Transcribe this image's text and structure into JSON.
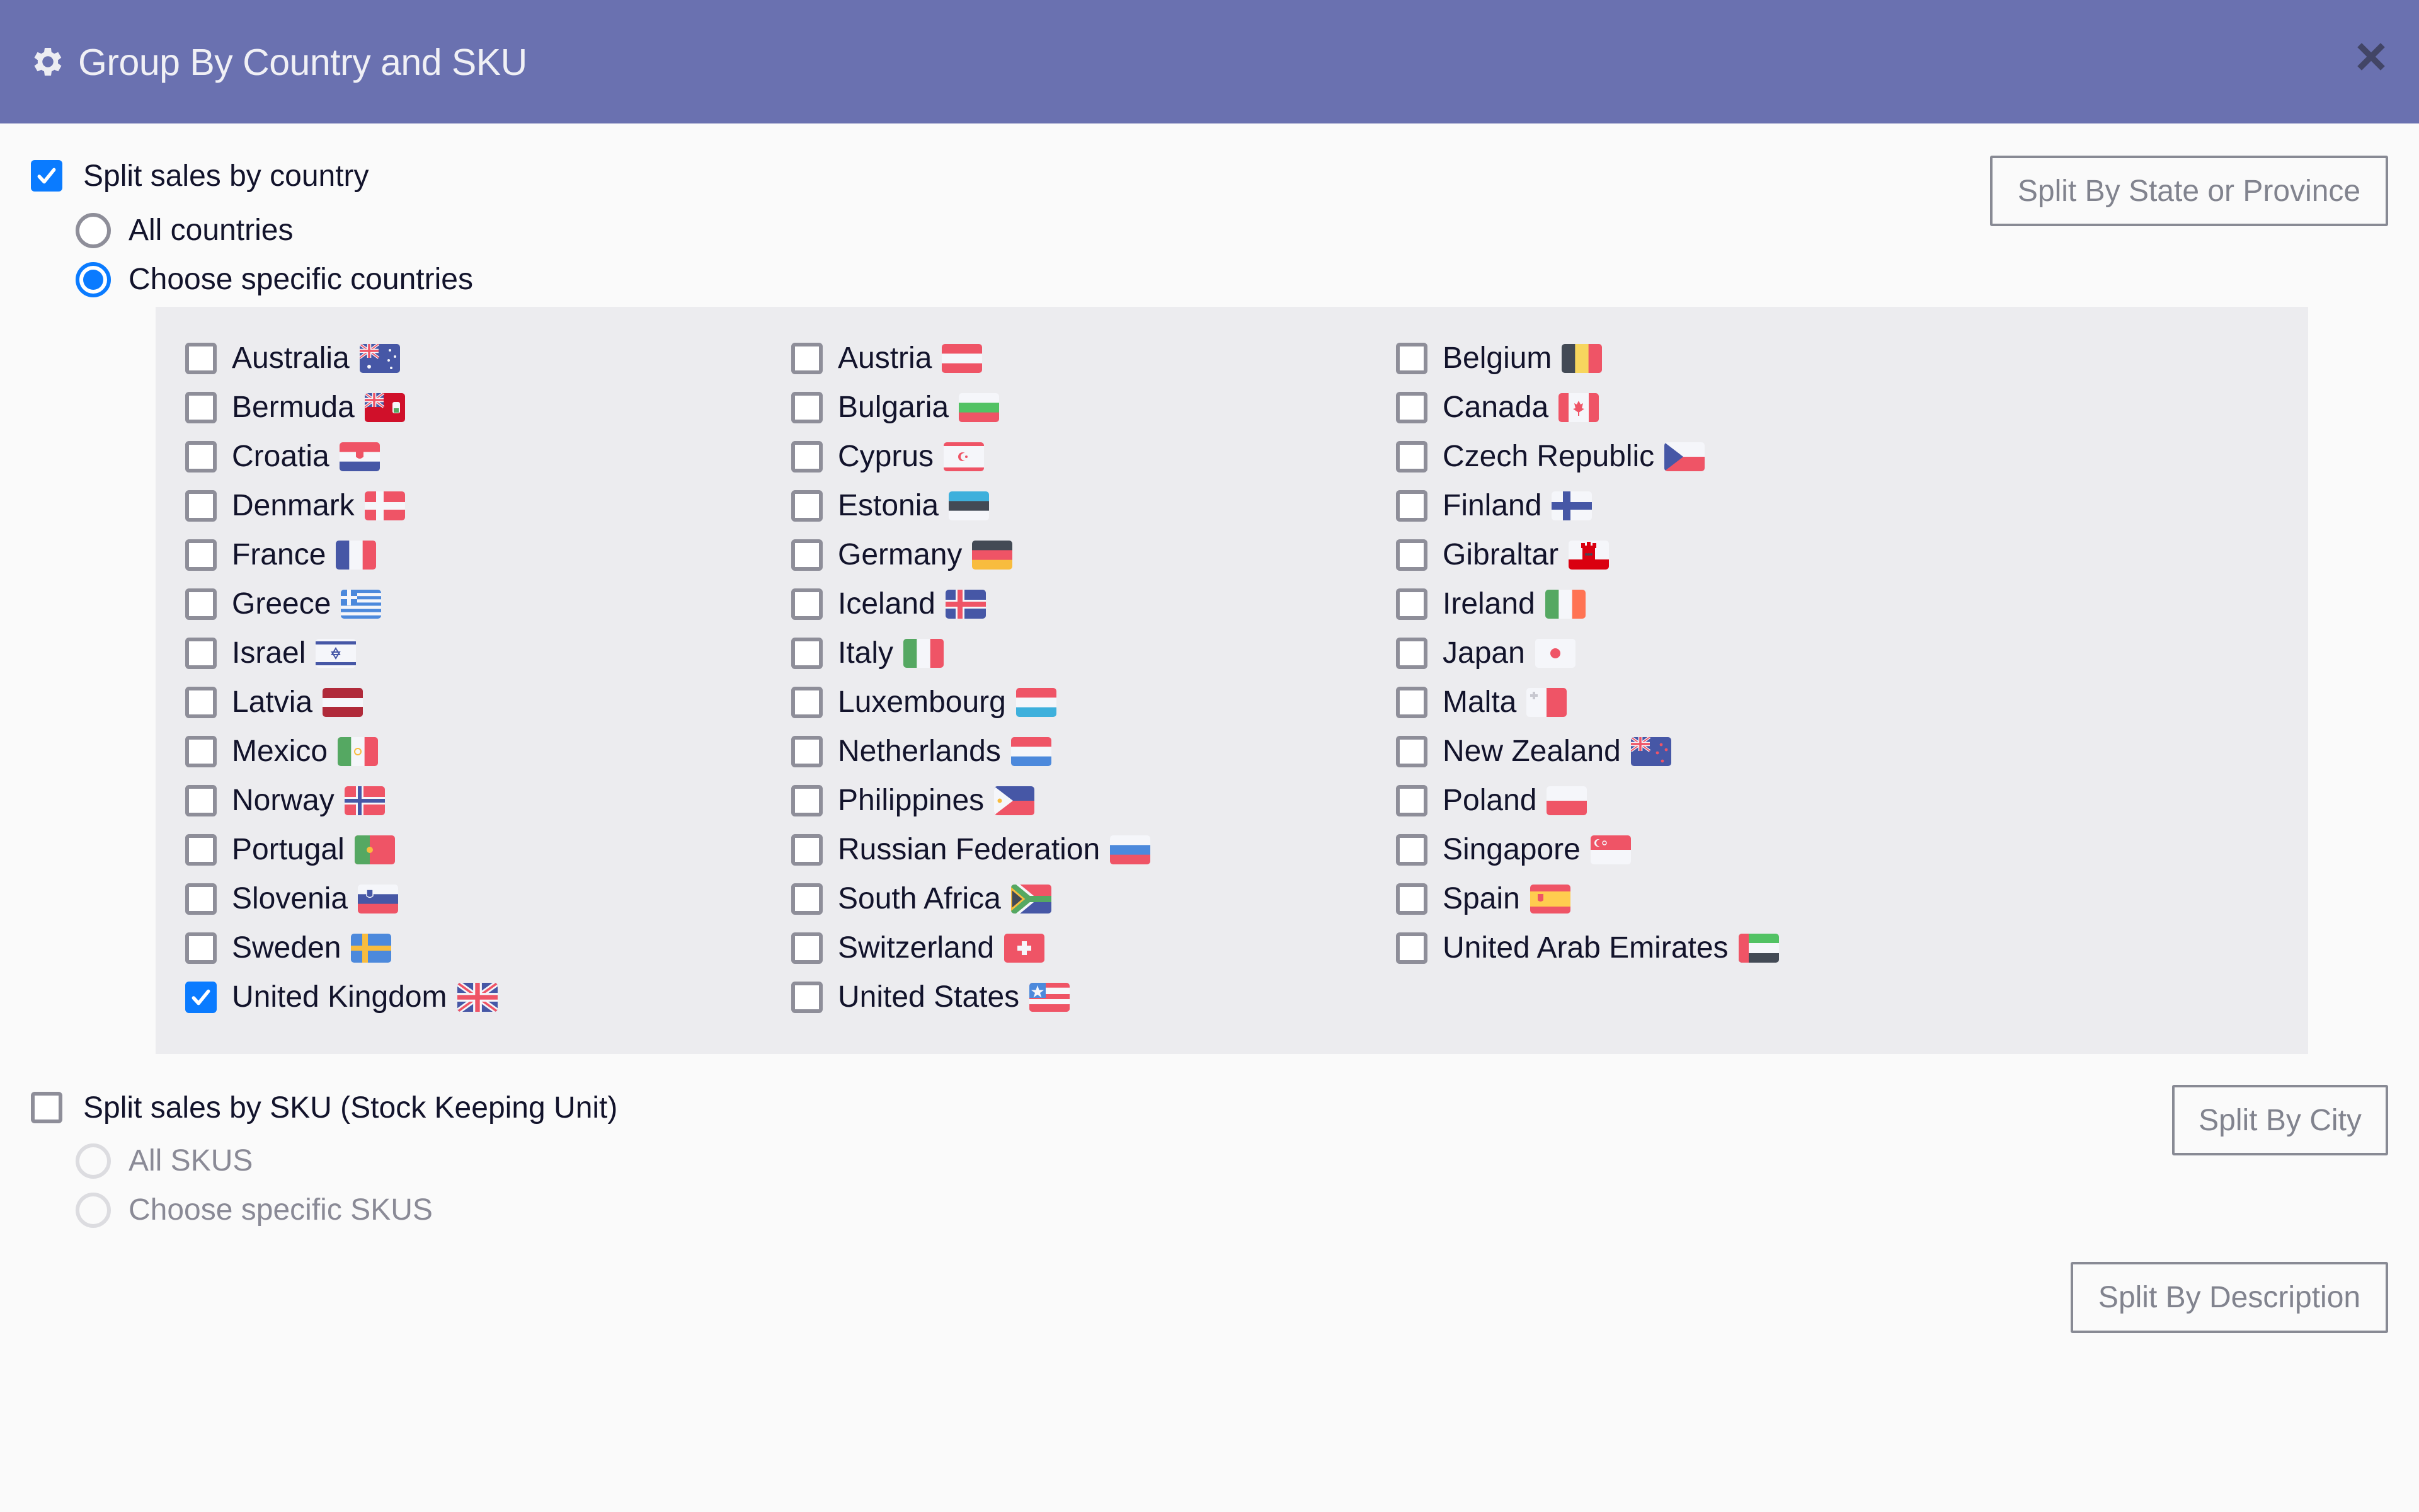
{
  "header": {
    "title": "Group By Country and SKU",
    "icon": "gear-icon",
    "close_icon": "close-icon",
    "background": "#6A71B0"
  },
  "country_section": {
    "checkbox_label": "Split sales by country",
    "checked": true,
    "radio_all_label": "All countries",
    "radio_specific_label": "Choose specific countries",
    "selected_option": "Choose specific countries"
  },
  "countries": {
    "columns": [
      [
        {
          "name": "Australia",
          "flag": "au",
          "checked": false
        },
        {
          "name": "Bermuda",
          "flag": "bm",
          "checked": false
        },
        {
          "name": "Croatia",
          "flag": "hr",
          "checked": false
        },
        {
          "name": "Denmark",
          "flag": "dk",
          "checked": false
        },
        {
          "name": "France",
          "flag": "fr",
          "checked": false
        },
        {
          "name": "Greece",
          "flag": "gr",
          "checked": false
        },
        {
          "name": "Israel",
          "flag": "il",
          "checked": false
        },
        {
          "name": "Latvia",
          "flag": "lv",
          "checked": false
        },
        {
          "name": "Mexico",
          "flag": "mx",
          "checked": false
        },
        {
          "name": "Norway",
          "flag": "no",
          "checked": false
        },
        {
          "name": "Portugal",
          "flag": "pt",
          "checked": false
        },
        {
          "name": "Slovenia",
          "flag": "si",
          "checked": false
        },
        {
          "name": "Sweden",
          "flag": "se",
          "checked": false
        },
        {
          "name": "United Kingdom",
          "flag": "gb",
          "checked": true
        }
      ],
      [
        {
          "name": "Austria",
          "flag": "at",
          "checked": false
        },
        {
          "name": "Bulgaria",
          "flag": "bg",
          "checked": false
        },
        {
          "name": "Cyprus",
          "flag": "cy",
          "checked": false
        },
        {
          "name": "Estonia",
          "flag": "ee",
          "checked": false
        },
        {
          "name": "Germany",
          "flag": "de",
          "checked": false
        },
        {
          "name": "Iceland",
          "flag": "is",
          "checked": false
        },
        {
          "name": "Italy",
          "flag": "it",
          "checked": false
        },
        {
          "name": "Luxembourg",
          "flag": "lu",
          "checked": false
        },
        {
          "name": "Netherlands",
          "flag": "nl",
          "checked": false
        },
        {
          "name": "Philippines",
          "flag": "ph",
          "checked": false
        },
        {
          "name": "Russian Federation",
          "flag": "ru",
          "checked": false
        },
        {
          "name": "South Africa",
          "flag": "za",
          "checked": false
        },
        {
          "name": "Switzerland",
          "flag": "ch",
          "checked": false
        },
        {
          "name": "United States",
          "flag": "us",
          "checked": false
        }
      ],
      [
        {
          "name": "Belgium",
          "flag": "be",
          "checked": false
        },
        {
          "name": "Canada",
          "flag": "ca",
          "checked": false
        },
        {
          "name": "Czech Republic",
          "flag": "cz",
          "checked": false
        },
        {
          "name": "Finland",
          "flag": "fi",
          "checked": false
        },
        {
          "name": "Gibraltar",
          "flag": "gi",
          "checked": false
        },
        {
          "name": "Ireland",
          "flag": "ie",
          "checked": false
        },
        {
          "name": "Japan",
          "flag": "jp",
          "checked": false
        },
        {
          "name": "Malta",
          "flag": "mt",
          "checked": false
        },
        {
          "name": "New Zealand",
          "flag": "nz",
          "checked": false
        },
        {
          "name": "Poland",
          "flag": "pl",
          "checked": false
        },
        {
          "name": "Singapore",
          "flag": "sg",
          "checked": false
        },
        {
          "name": "Spain",
          "flag": "es",
          "checked": false
        },
        {
          "name": "United Arab Emirates",
          "flag": "ae",
          "checked": false
        }
      ]
    ]
  },
  "sku_section": {
    "checkbox_label": "Split sales by SKU (Stock Keeping Unit)",
    "checked": false,
    "radio_all_label": "All SKUS",
    "radio_specific_label": "Choose specific SKUS",
    "disabled": true
  },
  "buttons": {
    "split_state": "Split By State or Province",
    "split_city": "Split By City",
    "split_description": "Split By Description"
  },
  "colors": {
    "accent": "#0A7BFF",
    "panel": "#ECECEF",
    "button_border": "#888A94"
  }
}
